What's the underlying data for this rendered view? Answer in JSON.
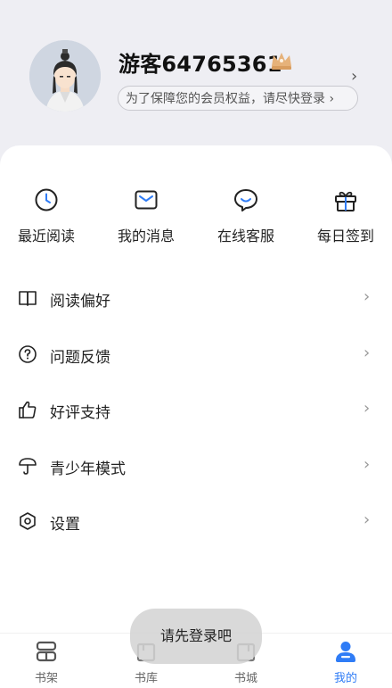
{
  "profile": {
    "username": "游客64765361",
    "login_hint": "为了保障您的会员权益，请尽快登录",
    "login_hint_chevron": "›"
  },
  "quick_actions": [
    {
      "label": "最近阅读",
      "icon": "clock-icon"
    },
    {
      "label": "我的消息",
      "icon": "envelope-icon"
    },
    {
      "label": "在线客服",
      "icon": "chat-smile-icon"
    },
    {
      "label": "每日签到",
      "icon": "gift-icon"
    }
  ],
  "menu": [
    {
      "label": "阅读偏好",
      "icon": "open-book-icon"
    },
    {
      "label": "问题反馈",
      "icon": "question-bubble-icon"
    },
    {
      "label": "好评支持",
      "icon": "thumbs-up-icon"
    },
    {
      "label": "青少年模式",
      "icon": "umbrella-icon"
    },
    {
      "label": "设置",
      "icon": "settings-icon"
    }
  ],
  "toast": {
    "text": "请先登录吧"
  },
  "tabbar": [
    {
      "label": "书架",
      "icon": "bookshelf-icon",
      "active": false
    },
    {
      "label": "书库",
      "icon": "library-icon",
      "active": false
    },
    {
      "label": "书城",
      "icon": "bookstore-icon",
      "active": false
    },
    {
      "label": "我的",
      "icon": "user-icon",
      "active": true
    }
  ],
  "colors": {
    "header_bg": "#eeeef3",
    "accent": "#2f7cf6",
    "crown": "#e6b27a"
  }
}
